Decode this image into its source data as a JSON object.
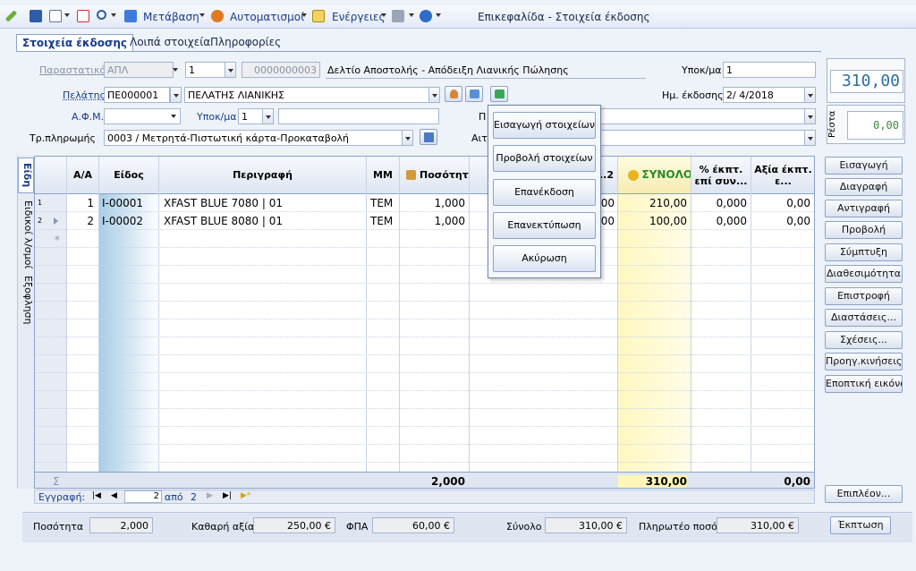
{
  "toolbar": {
    "navigate": "Μετάβαση",
    "automations": "Αυτοματισμοί",
    "actions": "Ενέργειες",
    "window_title": "Επικεφαλίδα - Στοιχεία έκδοσης"
  },
  "tabs": [
    "Στοιχεία έκδοσης",
    "Λοιπά στοιχεία",
    "Πληροφορίες"
  ],
  "header": {
    "doc_label": "Παραστατικό",
    "doc_series": "ΑΠΛ",
    "doc_number": "1",
    "doc_code": "0000000003",
    "doc_description": "Δελτίο Αποστολής - Απόδειξη Λιανικής Πώλησης",
    "branch_label": "Υποκ/μα",
    "branch_value": "1",
    "customer_label": "Πελάτης",
    "customer_code": "ΠΕ000001",
    "customer_name": "ΠΕΛΑΤΗΣ ΛΙΑΝΙΚΗΣ",
    "date_label": "Ημ. έκδοσης",
    "date_value": "2/ 4/2018",
    "vat_label": "Α.Φ.Μ.",
    "vat_value": "",
    "subbranch_label": "Υποκ/μα",
    "subbranch_value": "1",
    "payment_label": "Τρ.πληρωμής",
    "payment_value": "0003 / Μετρητά-Πιστωτική κάρτα-Προκαταβολή",
    "hidden_label_1": "Π",
    "hidden_label_2": "Αιτι"
  },
  "totals_display": {
    "total": "310,00",
    "change_label": "Ρέστα",
    "change": "0,00"
  },
  "side_tabs": [
    "Είδη",
    "Ειδικοί λ/σμοί",
    "Εξοφληση"
  ],
  "grid": {
    "columns": [
      "Α/Α",
      "Είδος",
      "Περιγραφή",
      "ΜΜ",
      "Ποσότητα",
      "ΣΥΝΟΛΟ",
      "% έκπτ. επί συν...",
      "Αξία έκπτ. ε..."
    ],
    "hidden_col_fragment": "..2",
    "rows": [
      {
        "num": "1",
        "aa": "1",
        "code": "I-00001",
        "desc": "XFAST BLUE 7080 | 01",
        "mm": "TEM",
        "qty": "1,000",
        "hidden": "00",
        "total": "210,00",
        "disc_pct": "0,000",
        "disc_val": "0,00"
      },
      {
        "num": "2",
        "aa": "2",
        "code": "I-00002",
        "desc": "XFAST BLUE 8080 | 01",
        "mm": "TEM",
        "qty": "1,000",
        "hidden": "00",
        "total": "100,00",
        "disc_pct": "0,000",
        "disc_val": "0,00"
      }
    ],
    "new_row_marker": "*",
    "sum_symbol": "Σ",
    "sum_qty": "2,000",
    "sum_total": "310,00",
    "sum_disc": "0,00"
  },
  "navigator": {
    "label": "Εγγραφή:",
    "current": "2",
    "of_label": "από",
    "count": "2"
  },
  "popup_menu": [
    "Εισαγωγή στοιχείων",
    "Προβολή στοιχείων",
    "Επανέκδοση",
    "Επανεκτύπωση",
    "Ακύρωση"
  ],
  "right_buttons": [
    "Εισαγωγή",
    "Διαγραφή",
    "Αντιγραφή",
    "Προβολή",
    "Σύμπτυξη",
    "Διαθεσιμότητα",
    "Επιστροφή",
    "Διαστάσεις...",
    "Σχέσεις...",
    "Προηγ.κινήσεις",
    "Εποπτική εικόνα"
  ],
  "more_button": "Επιπλέον...",
  "footer": {
    "qty_label": "Ποσότητα",
    "qty": "2,000",
    "net_label": "Καθαρή αξία",
    "net": "250,00 €",
    "vat_label": "ΦΠΑ",
    "vat": "60,00 €",
    "total_label": "Σύνολο",
    "total": "310,00 €",
    "payable_label": "Πληρωτέο ποσό",
    "payable": "310,00 €",
    "discount_button": "Έκπτωση"
  },
  "colors": {
    "accent": "#1a3d8a",
    "total_column": "#fffbd0",
    "lcd_text": "#2b6f9a"
  }
}
